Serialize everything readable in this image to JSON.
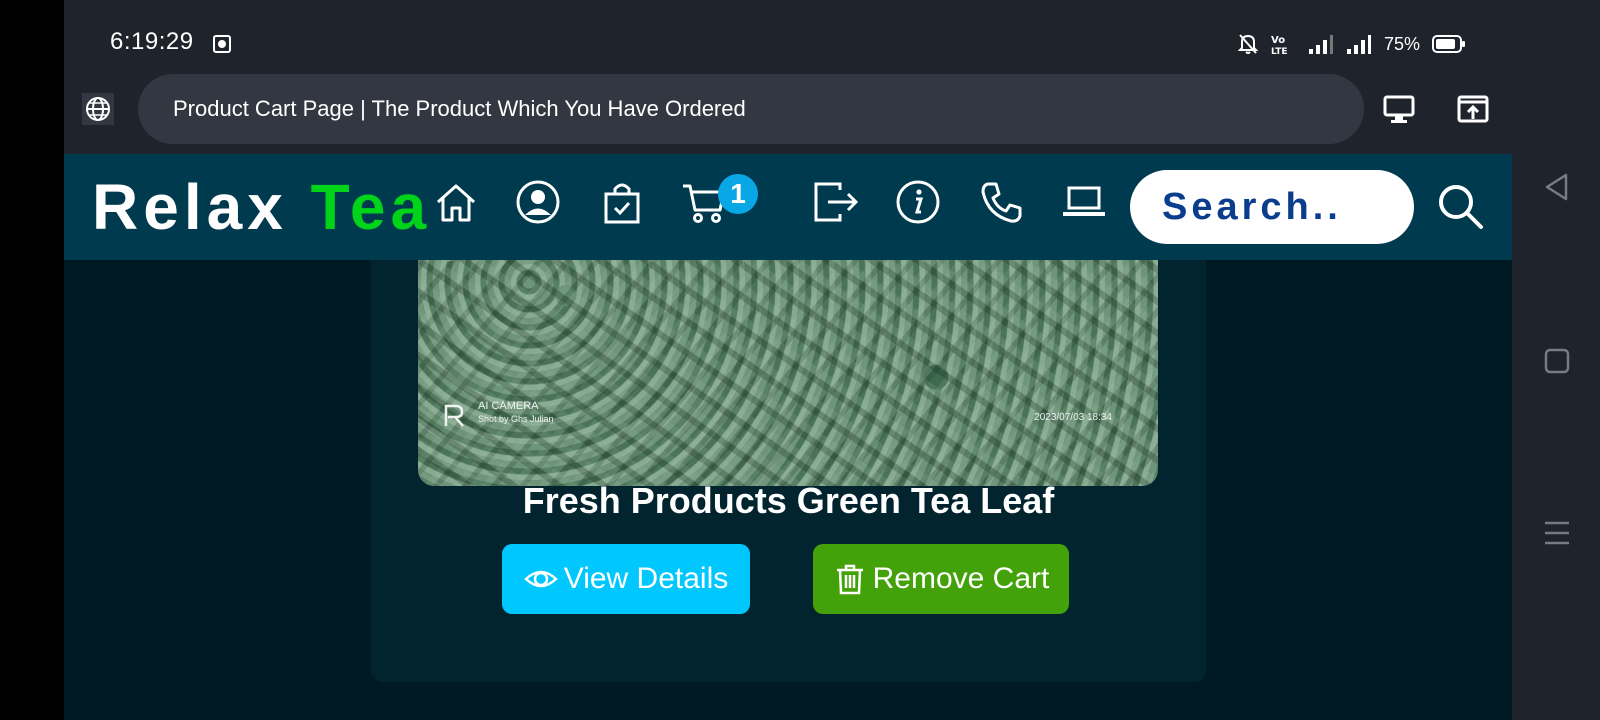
{
  "status_bar": {
    "time": "6:19:29",
    "battery_percent": "75%",
    "icons": [
      "notification-off-icon",
      "volte-icon",
      "signal-icon",
      "signal-icon",
      "battery-icon"
    ]
  },
  "browser": {
    "page_title": "Product Cart Page | The Product Which You Have Ordered",
    "icons": [
      "globe-icon",
      "desktop-site-icon",
      "share-icon"
    ]
  },
  "site_nav": {
    "logo_part1": "Relax ",
    "logo_part2": "Tea",
    "logo_accent_color": "#00d41a",
    "cart_count": "1",
    "search_text": "Search..",
    "icons": [
      "home-icon",
      "user-icon",
      "bag-check-icon",
      "cart-icon",
      "logout-icon",
      "info-icon",
      "phone-icon",
      "laptop-icon",
      "search-icon"
    ]
  },
  "product": {
    "name": "Fresh Products Green Tea Leaf",
    "image": {
      "watermark_title": "AI CAMERA",
      "watermark_sub": "Shot by Ghs Julian",
      "watermark_date": "2023/07/03 18:34"
    },
    "view_label": "View Details",
    "remove_label": "Remove Cart",
    "colors": {
      "view": "#00c8ff",
      "remove": "#43a10a"
    }
  },
  "android_nav": {
    "icons": [
      "back-icon",
      "home-square-icon",
      "menu-icon"
    ]
  }
}
